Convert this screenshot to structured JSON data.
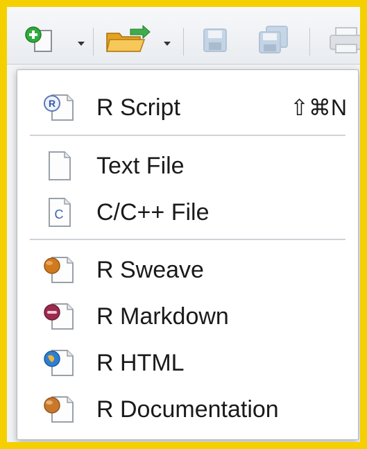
{
  "menu": {
    "items": [
      {
        "label": "R Script",
        "shortcut": "⇧⌘N",
        "icon": "r-script-file-icon"
      },
      {
        "label": "Text File",
        "icon": "text-file-icon"
      },
      {
        "label": "C/C++ File",
        "icon": "c-file-icon"
      },
      {
        "label": "R Sweave",
        "icon": "r-sweave-file-icon"
      },
      {
        "label": "R Markdown",
        "icon": "r-markdown-file-icon"
      },
      {
        "label": "R HTML",
        "icon": "r-html-file-icon"
      },
      {
        "label": "R Documentation",
        "icon": "r-documentation-file-icon"
      }
    ]
  },
  "colors": {
    "frame": "#f5d000",
    "new_file_green": "#2eaa3a",
    "folder_yellow": "#f2b632",
    "sweave_orange": "#d07a1f",
    "markdown_maroon": "#9b2c4e",
    "html_blue": "#2f7fcf",
    "rd_orange": "#c9782a"
  }
}
